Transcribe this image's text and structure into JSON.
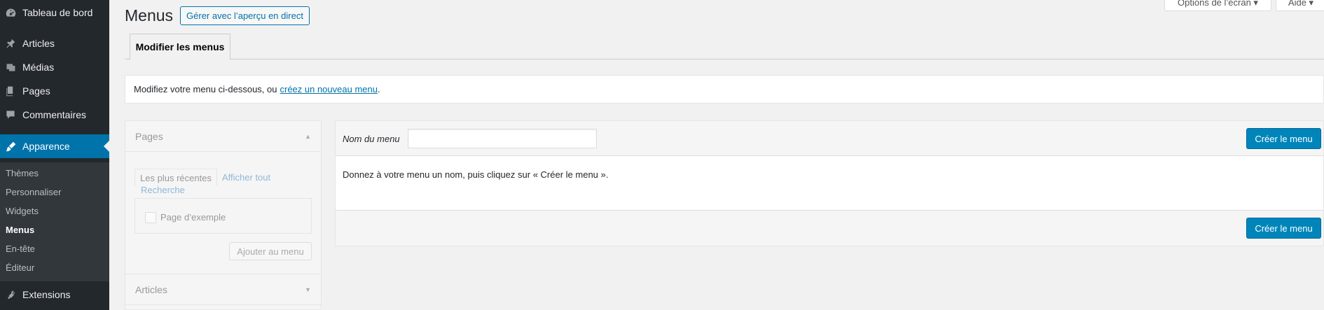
{
  "sidebar": {
    "items": [
      {
        "label": "Tableau de bord",
        "icon": "dashboard-icon"
      },
      {
        "label": "Articles",
        "icon": "pin-icon"
      },
      {
        "label": "Médias",
        "icon": "media-icon"
      },
      {
        "label": "Pages",
        "icon": "pages-icon"
      },
      {
        "label": "Commentaires",
        "icon": "comment-icon"
      },
      {
        "label": "Apparence",
        "icon": "brush-icon"
      },
      {
        "label": "Extensions",
        "icon": "plugin-icon"
      }
    ],
    "submenu": [
      "Thèmes",
      "Personnaliser",
      "Widgets",
      "Menus",
      "En-tête",
      "Éditeur"
    ]
  },
  "header": {
    "title": "Menus",
    "live_button": "Gérer avec l’aperçu en direct",
    "screen_options": "Options de l’écran ▾",
    "help": "Aide ▾"
  },
  "tabs": {
    "edit": "Modifier les menus"
  },
  "notice": {
    "text": "Modifiez votre menu ci-dessous, ou",
    "link": "créez un nouveau menu",
    "end": "."
  },
  "accordion": {
    "pages_title": "Pages",
    "tab_recent": "Les plus récentes",
    "tab_all": "Afficher tout",
    "tab_search": "Recherche",
    "sample_page": "Page d’exemple",
    "add_button": "Ajouter au menu",
    "articles_title": "Articles"
  },
  "menu_editor": {
    "name_label": "Nom du menu",
    "name_value": "",
    "create_button": "Créer le menu",
    "instruction": "Donnez à votre menu un nom, puis cliquez sur « Créer le menu »."
  },
  "colors": {
    "accent": "#0073aa",
    "primary_button": "#0085ba",
    "sidebar_bg": "#23282d"
  }
}
